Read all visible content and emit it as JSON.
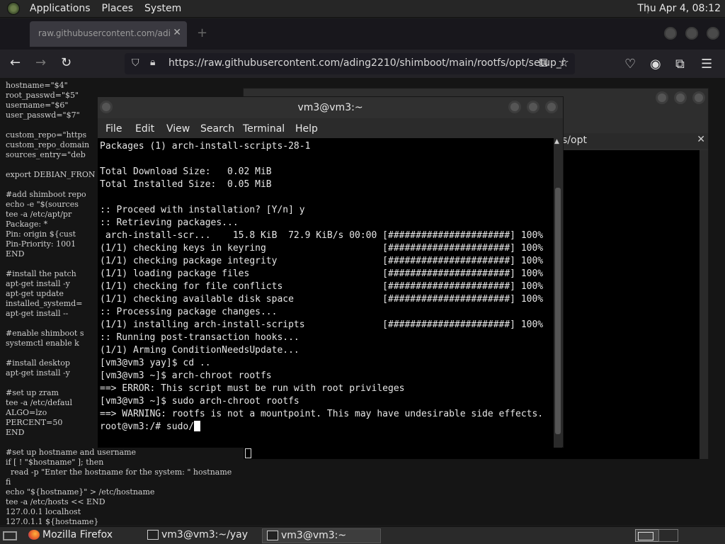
{
  "top_panel": {
    "applications": "Applications",
    "places": "Places",
    "system": "System",
    "clock": "Thu Apr  4, 08:12"
  },
  "firefox": {
    "tab_title": "raw.githubusercontent.com/adi",
    "url": "https://raw.githubusercontent.com/ading2210/shimboot/main/rootfs/opt/setup_r"
  },
  "page_code": [
    "hostname=\"$4\"",
    "root_passwd=\"$5\"",
    "username=\"$6\"",
    "user_passwd=\"$7\"",
    "",
    "custom_repo=\"https",
    "custom_repo_domain",
    "sources_entry=\"deb",
    "",
    "export DEBIAN_FRON",
    "",
    "#add shimboot repo",
    "echo -e \"$(sources",
    "tee -a /etc/apt/pr",
    "Package: *",
    "Pin: origin ${cust",
    "Pin-Priority: 1001",
    "END",
    "",
    "#install the patch",
    "apt-get install -y",
    "apt-get update",
    "installed_systemd=",
    "apt-get install --",
    "",
    "#enable shimboot s",
    "systemctl enable k",
    "",
    "#install desktop",
    "apt-get install -y",
    "",
    "#set up zram",
    "tee -a /etc/defaul",
    "ALGO=lzo",
    "PERCENT=50",
    "END",
    "",
    "#set up hostname and username",
    "if [ ! \"$hostname\" ]; then",
    "  read -p \"Enter the hostname for the system: \" hostname",
    "fi",
    "echo \"${hostname}\" > /etc/hostname",
    "tee -a /etc/hosts << END",
    "127.0.0.1 localhost",
    "127.0.1.1 ${hostname}"
  ],
  "back_terminal": {
    "tab_label": "s/opt"
  },
  "terminal": {
    "title": "vm3@vm3:~",
    "menu": [
      "File",
      "Edit",
      "View",
      "Search",
      "Terminal",
      "Help"
    ],
    "lines": [
      "Packages (1) arch-install-scripts-28-1",
      "",
      "Total Download Size:   0.02 MiB",
      "Total Installed Size:  0.05 MiB",
      "",
      ":: Proceed with installation? [Y/n] y",
      ":: Retrieving packages...",
      " arch-install-scr...    15.8 KiB  72.9 KiB/s 00:00 [######################] 100%",
      "(1/1) checking keys in keyring                     [######################] 100%",
      "(1/1) checking package integrity                   [######################] 100%",
      "(1/1) loading package files                        [######################] 100%",
      "(1/1) checking for file conflicts                  [######################] 100%",
      "(1/1) checking available disk space                [######################] 100%",
      ":: Processing package changes...",
      "(1/1) installing arch-install-scripts              [######################] 100%",
      ":: Running post-transaction hooks...",
      "(1/1) Arming ConditionNeedsUpdate...",
      "[vm3@vm3 yay]$ cd ..",
      "[vm3@vm3 ~]$ arch-chroot rootfs",
      "==> ERROR: This script must be run with root privileges",
      "[vm3@vm3 ~]$ sudo arch-chroot rootfs",
      "==> WARNING: rootfs is not a mountpoint. This may have undesirable side effects."
    ],
    "prompt_line": "root@vm3:/# sudo/"
  },
  "taskbar": {
    "items": [
      {
        "label": "Mozilla Firefox"
      },
      {
        "label": "vm3@vm3:~/yay"
      },
      {
        "label": "vm3@vm3:~"
      }
    ]
  }
}
